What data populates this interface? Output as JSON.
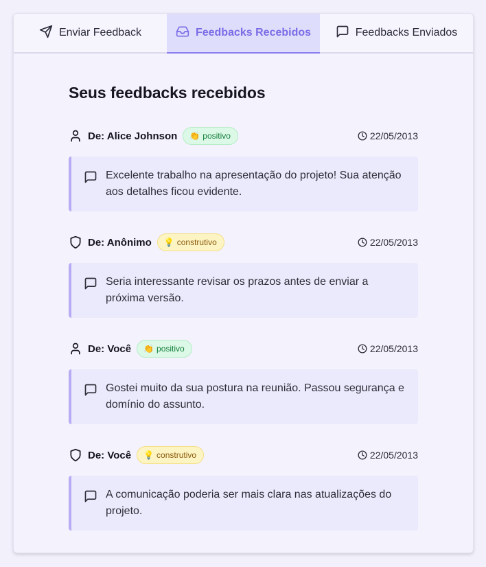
{
  "tabs": [
    {
      "label": "Enviar Feedback",
      "icon": "send-icon",
      "active": false
    },
    {
      "label": "Feedbacks Recebidos",
      "icon": "inbox-icon",
      "active": true
    },
    {
      "label": "Feedbacks Enviados",
      "icon": "message-icon",
      "active": false
    }
  ],
  "page_title": "Seus feedbacks recebidos",
  "colors": {
    "accent": "#7c6be6",
    "positive_bg": "#dcf8e6",
    "constructive_bg": "#fdf4c3"
  },
  "feedbacks": [
    {
      "from": "De: Alice Johnson",
      "author_icon": "user-icon",
      "badge_emoji": "👏",
      "badge": "positivo",
      "type": "positive",
      "date": "22/05/2013",
      "text": "Excelente trabalho na apresentação do projeto! Sua atenção aos detalhes ficou evidente."
    },
    {
      "from": "De: Anônimo",
      "author_icon": "shield-icon",
      "badge_emoji": "💡",
      "badge": "construtivo",
      "type": "constructive",
      "date": "22/05/2013",
      "text": "Seria interessante revisar os prazos antes de enviar a próxima versão."
    },
    {
      "from": "De: Você",
      "author_icon": "user-icon",
      "badge_emoji": "👏",
      "badge": "positivo",
      "type": "positive",
      "date": "22/05/2013",
      "text": "Gostei muito da sua postura na reunião. Passou segurança e domínio do assunto."
    },
    {
      "from": "De: Você",
      "author_icon": "shield-icon",
      "badge_emoji": "💡",
      "badge": "construtivo",
      "type": "constructive",
      "date": "22/05/2013",
      "text": "A comunicação poderia ser mais clara nas atualizações do projeto."
    }
  ]
}
